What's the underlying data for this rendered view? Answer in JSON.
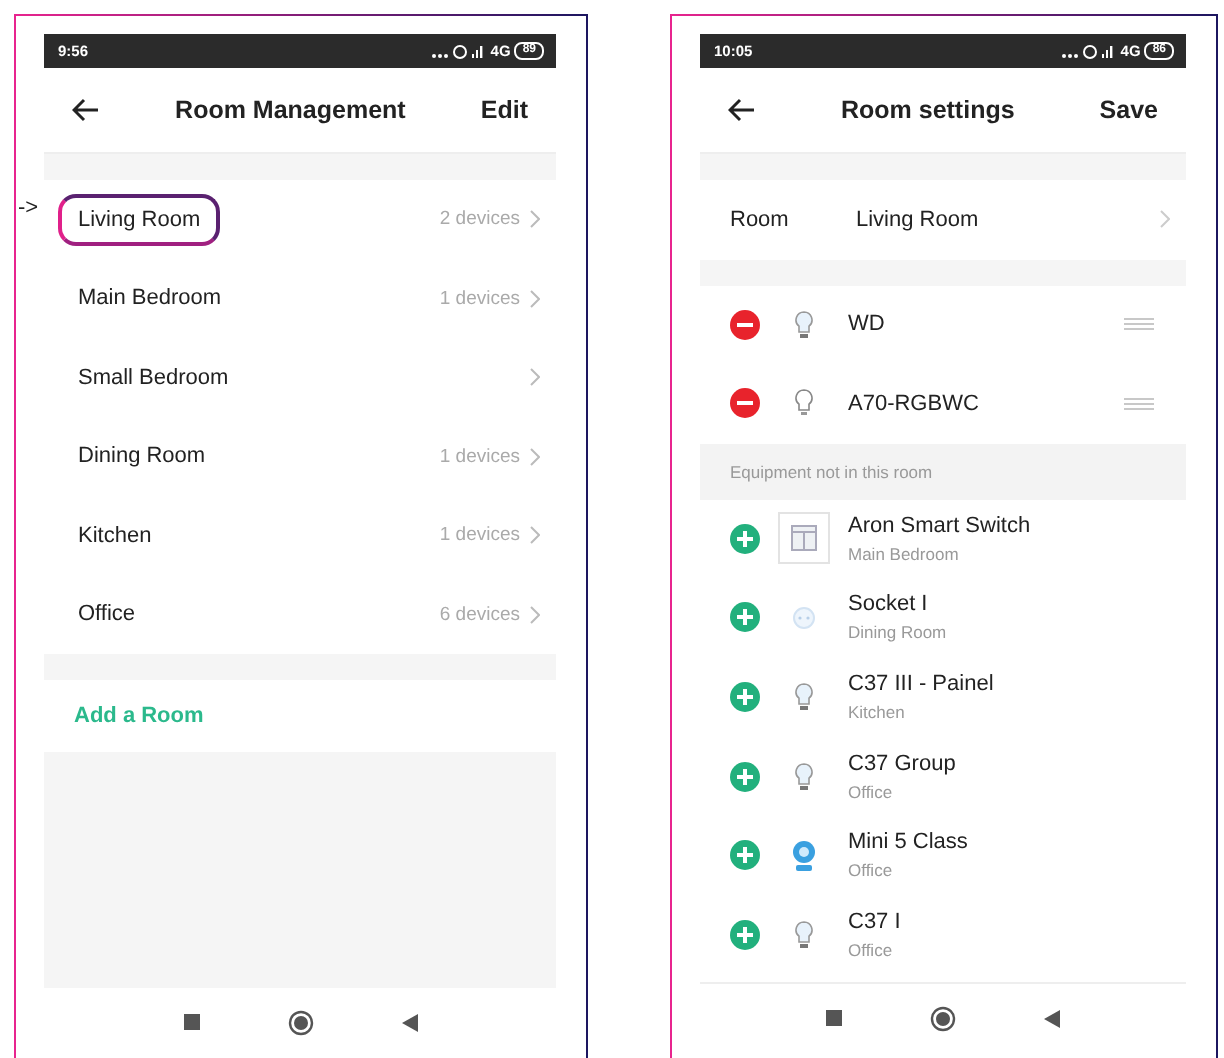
{
  "left_phone": {
    "status_bar": {
      "time": "9:56",
      "network": "4G",
      "battery": "89"
    },
    "header": {
      "title": "Room Management",
      "action": "Edit"
    },
    "pointer": "->",
    "rooms": [
      {
        "name": "Living Room",
        "count": "2 devices",
        "highlighted": true
      },
      {
        "name": "Main Bedroom",
        "count": "1 devices",
        "highlighted": false
      },
      {
        "name": "Small Bedroom",
        "highlighted": false
      },
      {
        "name": "Dining Room",
        "count": "1 devices",
        "highlighted": false
      },
      {
        "name": "Kitchen",
        "count": "1 devices",
        "highlighted": false
      },
      {
        "name": "Office",
        "count": "6 devices",
        "highlighted": false
      }
    ],
    "add_room": "Add a Room"
  },
  "right_phone": {
    "status_bar": {
      "time": "10:05",
      "network": "4G",
      "battery": "86"
    },
    "header": {
      "title": "Room settings",
      "action": "Save"
    },
    "room_field": {
      "label": "Room",
      "value": "Living Room"
    },
    "devices_in_room": [
      {
        "name": "WD",
        "kind": "bulb"
      },
      {
        "name": "A70-RGBWC",
        "kind": "bulb-outline"
      }
    ],
    "section_header": "Equipment not in this room",
    "devices_not_in_room": [
      {
        "name": "Aron Smart Switch",
        "room": "Main Bedroom",
        "kind": "switch"
      },
      {
        "name": "Socket I",
        "room": "Dining Room",
        "kind": "socket"
      },
      {
        "name": "C37 III - Painel",
        "room": "Kitchen",
        "kind": "bulb"
      },
      {
        "name": "C37 Group",
        "room": "Office",
        "kind": "bulb"
      },
      {
        "name": "Mini 5 Class",
        "room": "Office",
        "kind": "camera"
      },
      {
        "name": "C37 I",
        "room": "Office",
        "kind": "bulb"
      }
    ]
  }
}
